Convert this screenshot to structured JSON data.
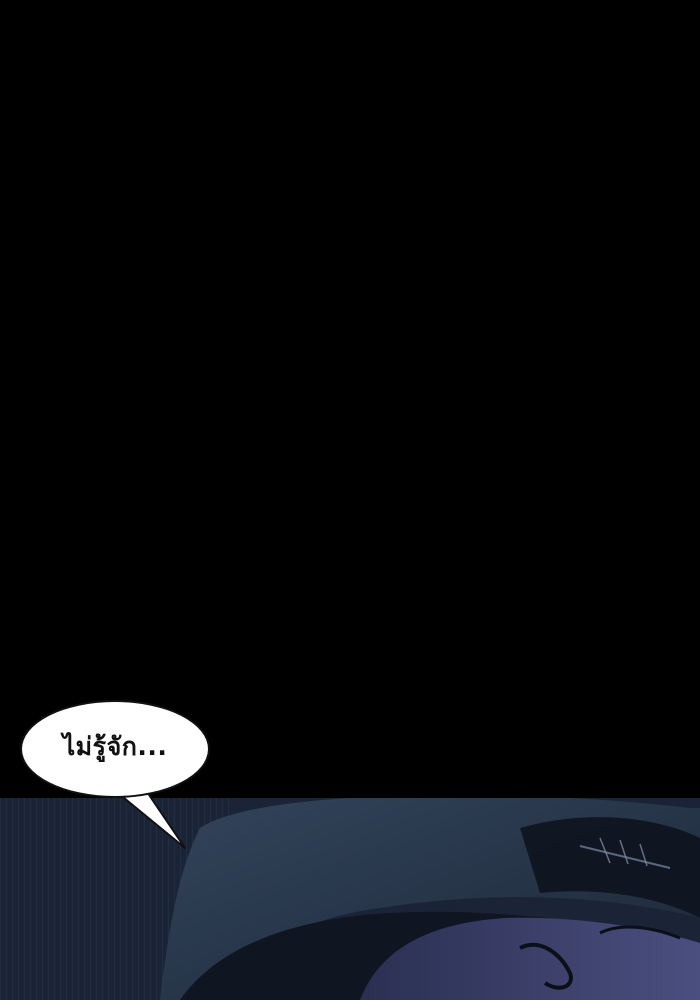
{
  "speech_bubble": {
    "text": "ไม่รู้จัก..."
  },
  "colors": {
    "background": "#000000",
    "panel_blue": "#1f2b3e",
    "bubble_fill": "#ffffff",
    "bubble_outline": "#111111"
  }
}
